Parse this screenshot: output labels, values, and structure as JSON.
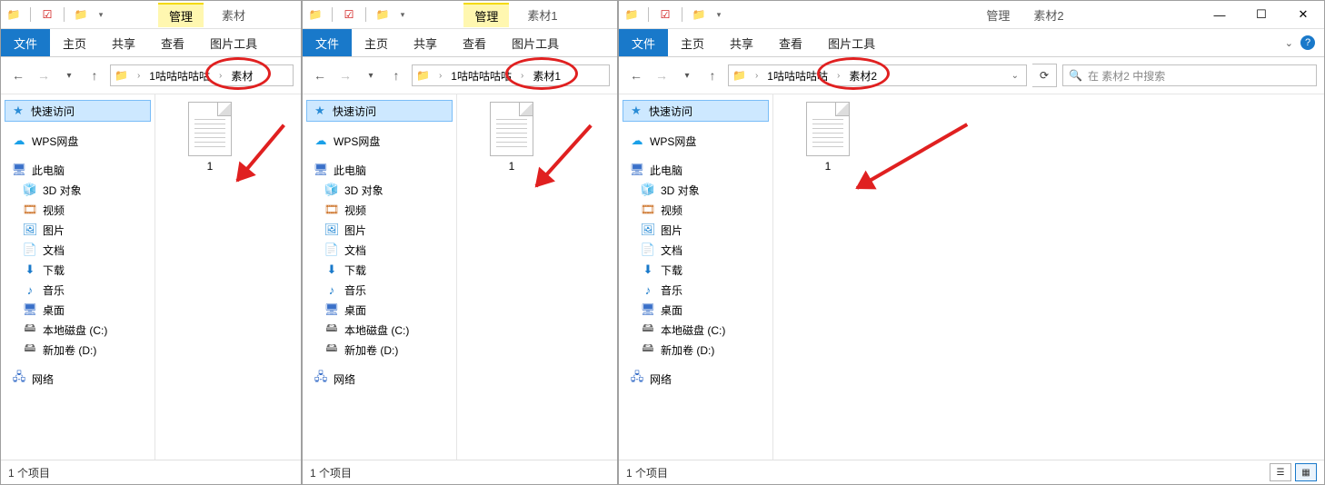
{
  "common": {
    "ribbon": {
      "file": "文件",
      "home": "主页",
      "share": "共享",
      "view": "查看",
      "picture_tools": "图片工具"
    },
    "title": {
      "manage": "管理"
    },
    "sidebar": {
      "quick": "快速访问",
      "wps": "WPS网盘",
      "this_pc": "此电脑",
      "objects3d": "3D 对象",
      "videos": "视频",
      "pictures": "图片",
      "documents": "文档",
      "downloads": "下载",
      "music": "音乐",
      "desktop": "桌面",
      "local_c": "本地磁盘 (C:)",
      "new_vol_d": "新加卷 (D:)",
      "network": "网络"
    },
    "status": {
      "one_item": "1 个项目"
    },
    "file": {
      "name": "1"
    }
  },
  "windows": [
    {
      "title_tab": "素材",
      "breadcrumb_parent": "1咕咕咕咕咕",
      "breadcrumb_current": "素材"
    },
    {
      "title_tab": "素材1",
      "breadcrumb_parent": "1咕咕咕咕咕",
      "breadcrumb_current": "素材1"
    },
    {
      "title_tab": "素材2",
      "breadcrumb_parent": "1咕咕咕咕咕",
      "breadcrumb_current": "素材2",
      "search_placeholder": "在 素材2 中搜索"
    }
  ]
}
